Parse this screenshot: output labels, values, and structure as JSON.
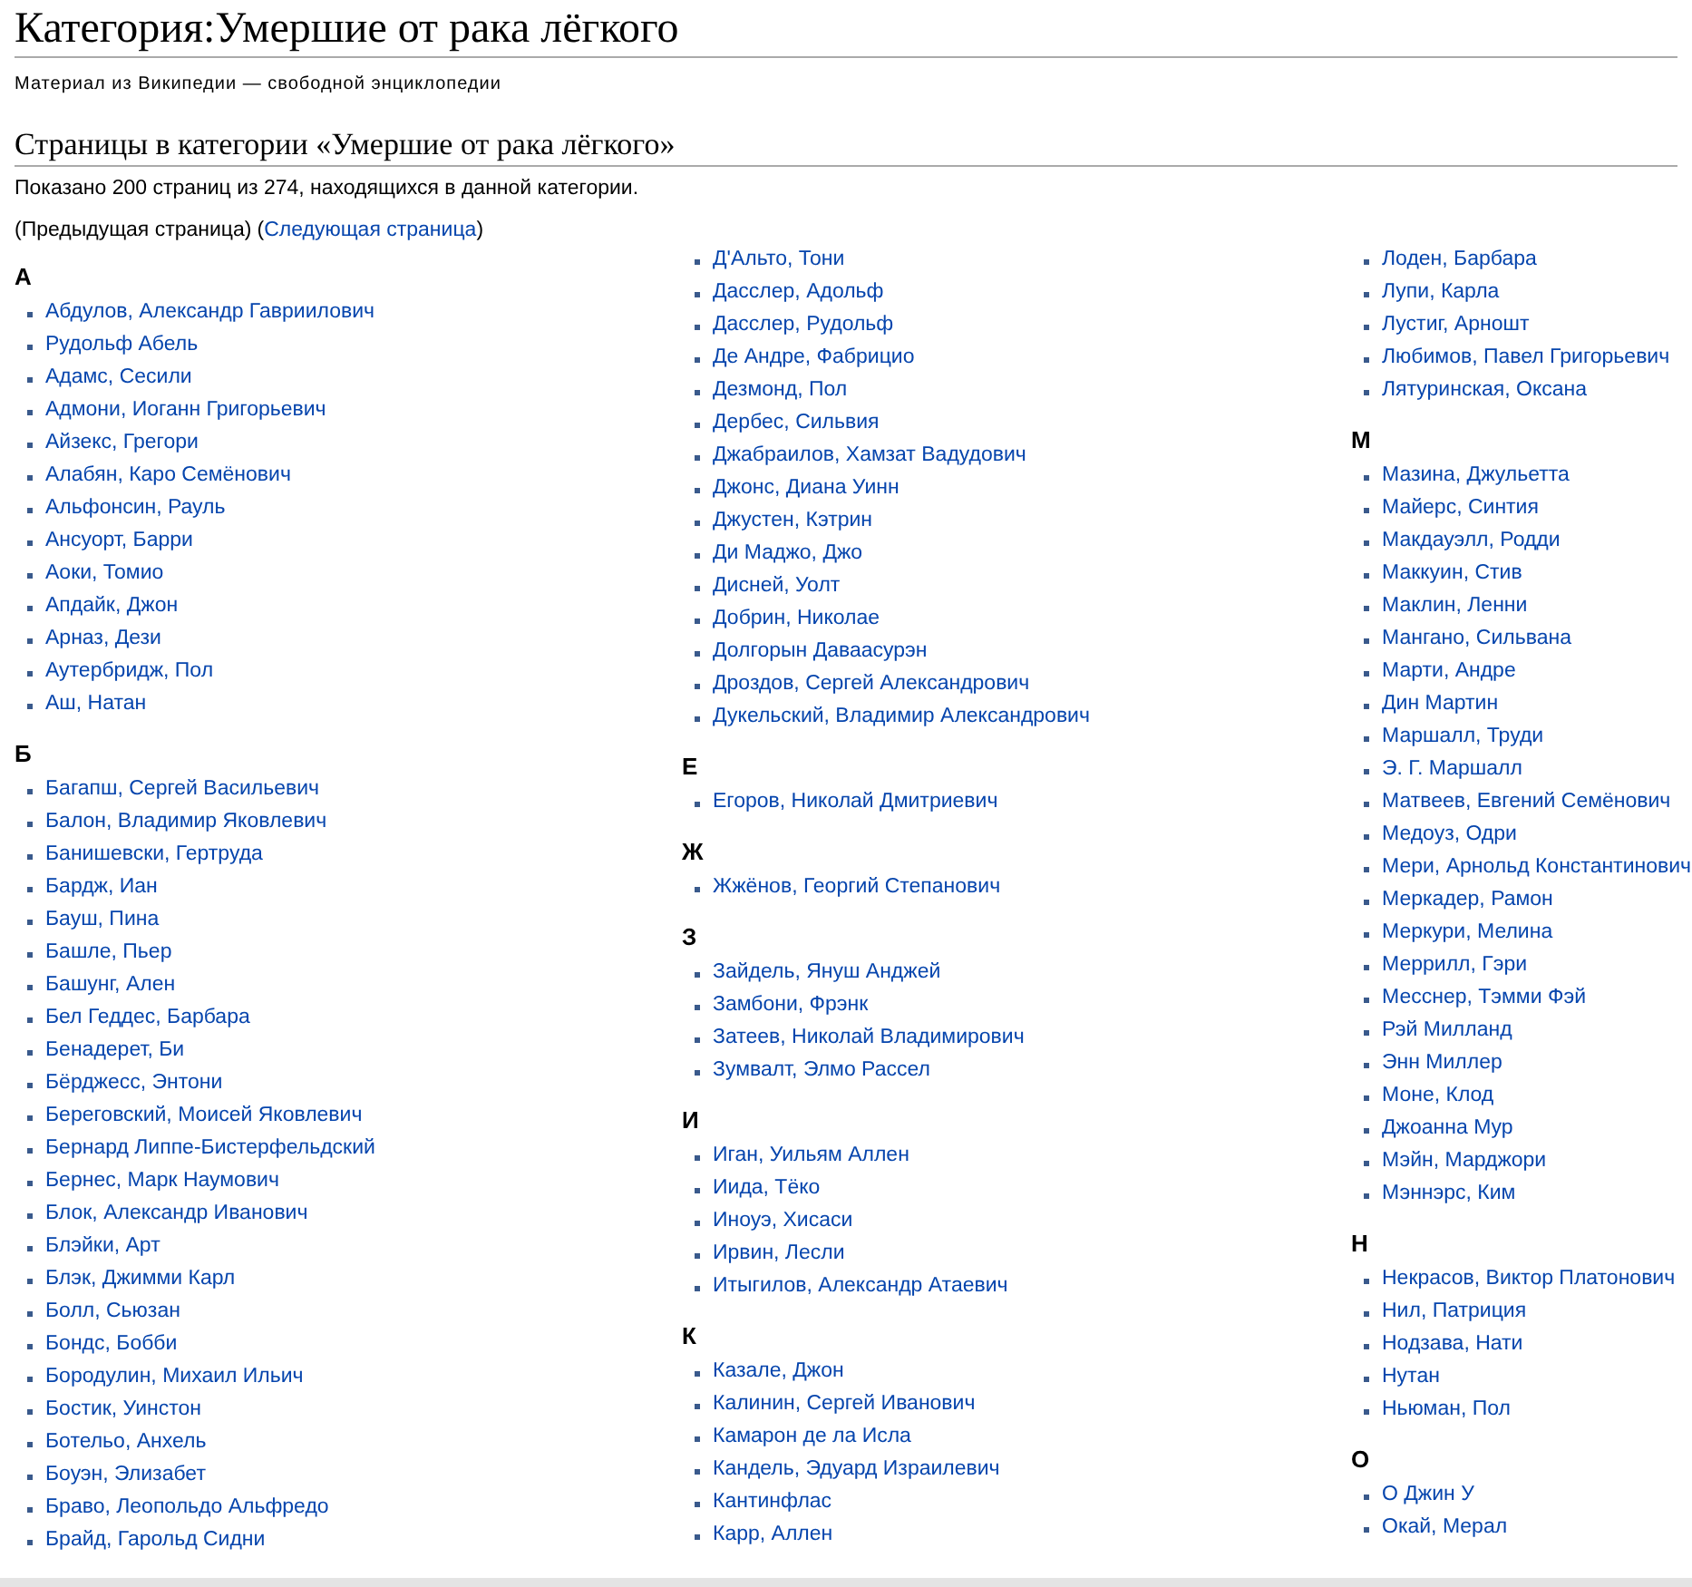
{
  "title": "Категория:Умершие от рака лёгкого",
  "subtitle": "Материал из Википедии — свободной энциклопедии",
  "section_heading": "Страницы в категории «Умершие от рака лёгкого»",
  "summary": "Показано 200 страниц из 274, находящихся в данной категории.",
  "nav": {
    "prev": "(Предыдущая страница)",
    "open": "(",
    "next": "Следующая страница",
    "close": ")"
  },
  "columns": [
    {
      "groups": [
        {
          "letter": "А",
          "items": [
            "Абдулов, Александр Гавриилович",
            "Рудольф Абель",
            "Адамс, Сесили",
            "Адмони, Иоганн Григорьевич",
            "Айзекс, Грегори",
            "Алабян, Каро Семёнович",
            "Альфонсин, Рауль",
            "Ансуорт, Барри",
            "Аоки, Томио",
            "Апдайк, Джон",
            "Арназ, Дези",
            "Аутербридж, Пол",
            "Аш, Натан"
          ]
        },
        {
          "letter": "Б",
          "items": [
            "Багапш, Сергей Васильевич",
            "Балон, Владимир Яковлевич",
            "Банишевски, Гертруда",
            "Бардж, Иан",
            "Бауш, Пина",
            "Башле, Пьер",
            "Башунг, Ален",
            "Бел Геддес, Барбара",
            "Бенадерет, Би",
            "Бёрджесс, Энтони",
            "Береговский, Моисей Яковлевич",
            "Бернард Липпе-Бистерфельдский",
            "Бернес, Марк Наумович",
            "Блок, Александр Иванович",
            "Блэйки, Арт",
            "Блэк, Джимми Карл",
            "Болл, Сьюзан",
            "Бондс, Бобби",
            "Бородулин, Михаил Ильич",
            "Бостик, Уинстон",
            "Ботельо, Анхель",
            "Боуэн, Элизабет",
            "Браво, Леопольдо Альфредо",
            "Брайд, Гарольд Сидни"
          ]
        }
      ]
    },
    {
      "groups": [
        {
          "items": [
            "Д'Альто, Тони",
            "Дасслер, Адольф",
            "Дасслер, Рудольф",
            "Де Андре, Фабрицио",
            "Дезмонд, Пол",
            "Дербес, Сильвия",
            "Джабраилов, Хамзат Вадудович",
            "Джонс, Диана Уинн",
            "Джустен, Кэтрин",
            "Ди Маджо, Джо",
            "Дисней, Уолт",
            "Добрин, Николае",
            "Долгорын Даваасурэн",
            "Дроздов, Сергей Александрович",
            "Дукельский, Владимир Александрович"
          ]
        },
        {
          "letter": "Е",
          "items": [
            "Егоров, Николай Дмитриевич"
          ]
        },
        {
          "letter": "Ж",
          "items": [
            "Жжёнов, Георгий Степанович"
          ]
        },
        {
          "letter": "З",
          "items": [
            "Зайдель, Януш Анджей",
            "Замбони, Фрэнк",
            "Затеев, Николай Владимирович",
            "Зумвалт, Элмо Рассел"
          ]
        },
        {
          "letter": "И",
          "items": [
            "Иган, Уильям Аллен",
            "Иида, Тёко",
            "Иноуэ, Хисаси",
            "Ирвин, Лесли",
            "Итыгилов, Александр Атаевич"
          ]
        },
        {
          "letter": "К",
          "items": [
            "Казале, Джон",
            "Калинин, Сергей Иванович",
            "Камарон де ла Исла",
            "Кандель, Эдуард Израилевич",
            "Кантинфлас",
            "Карр, Аллен"
          ]
        }
      ]
    },
    {
      "groups": [
        {
          "items": [
            "Лоден, Барбара",
            "Лупи, Карла",
            "Лустиг, Арношт",
            "Любимов, Павел Григорьевич",
            "Лятуринская, Оксана"
          ]
        },
        {
          "letter": "М",
          "items": [
            "Мазина, Джульетта",
            "Майерс, Синтия",
            "Макдауэлл, Родди",
            "Маккуин, Стив",
            "Маклин, Ленни",
            "Мангано, Сильвана",
            "Марти, Андре",
            "Дин Мартин",
            "Маршалл, Труди",
            "Э. Г. Маршалл",
            "Матвеев, Евгений Семёнович",
            "Медоуз, Одри",
            "Мери, Арнольд Константинович",
            "Меркадер, Рамон",
            "Меркури, Мелина",
            "Меррилл, Гэри",
            "Месснер, Тэмми Фэй",
            "Рэй Милланд",
            "Энн Миллер",
            "Моне, Клод",
            "Джоанна Мур",
            "Мэйн, Марджори",
            "Мэннэрс, Ким"
          ]
        },
        {
          "letter": "Н",
          "items": [
            "Некрасов, Виктор Платонович",
            "Нил, Патриция",
            "Нодзава, Нати",
            "Нутан",
            "Ньюман, Пол"
          ]
        },
        {
          "letter": "О",
          "items": [
            "О Джин У",
            "Окай, Мерал"
          ]
        }
      ]
    }
  ]
}
